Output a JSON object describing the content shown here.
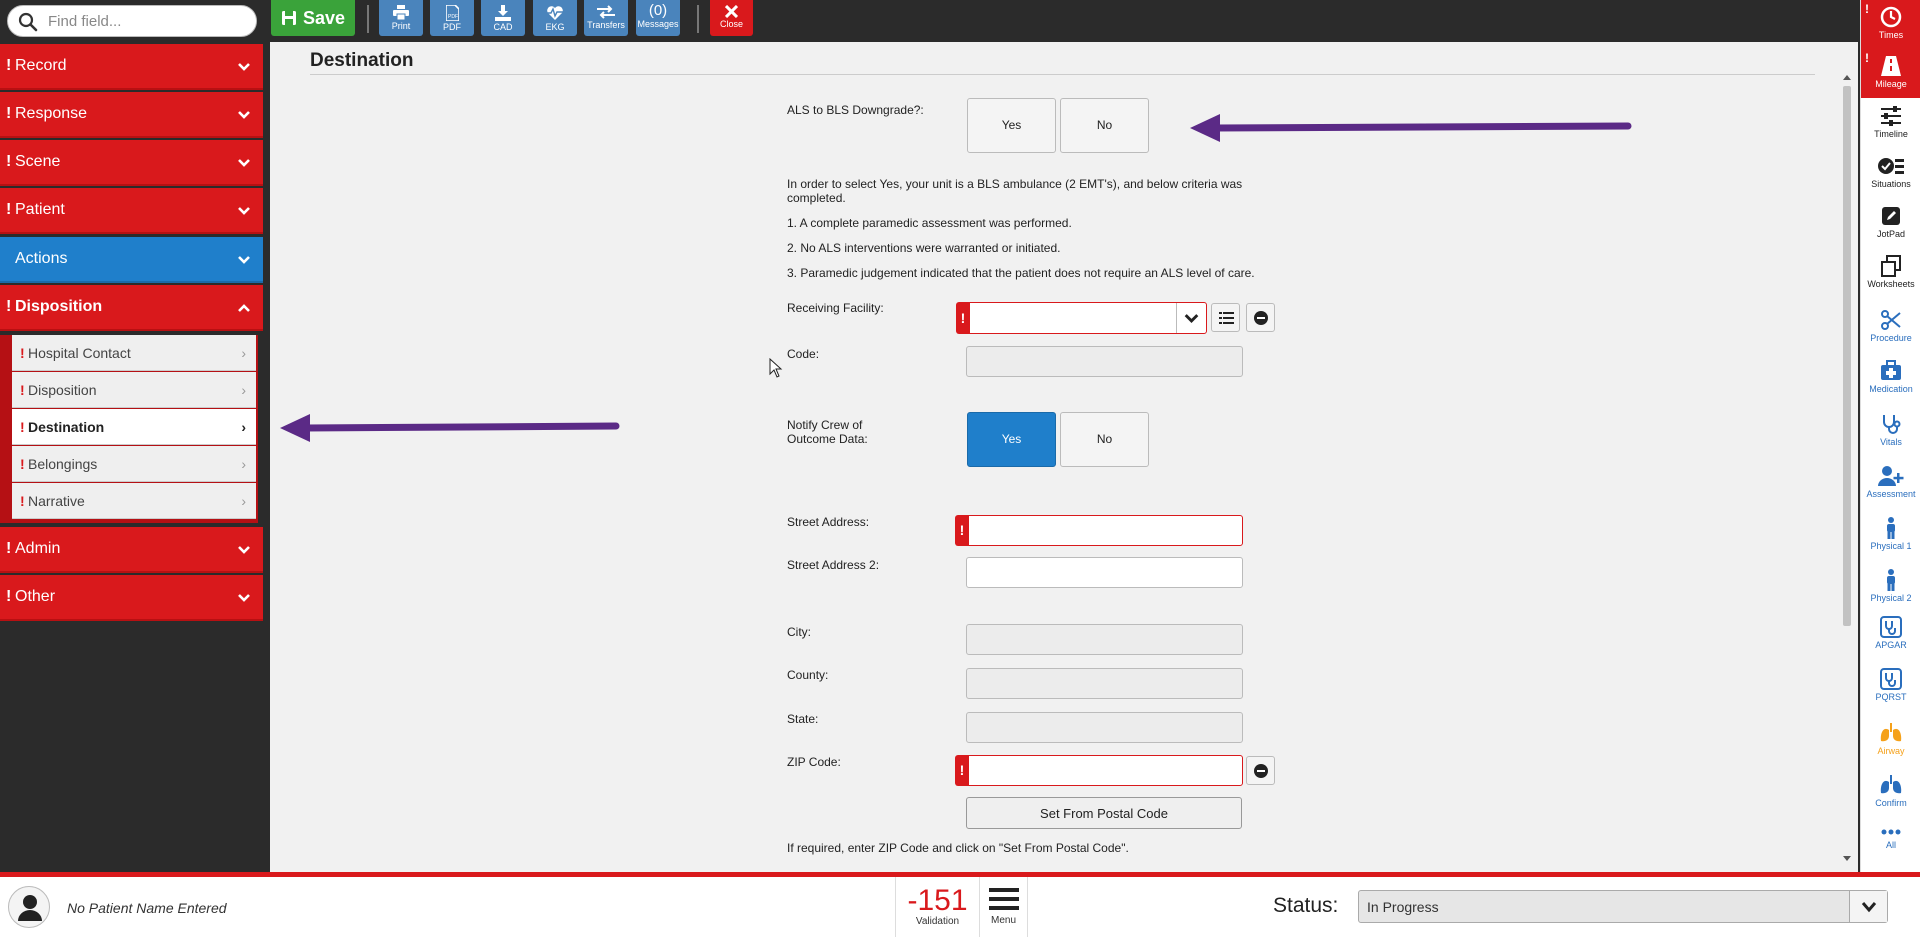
{
  "search": {
    "placeholder": "Find field..."
  },
  "toolbar": {
    "save_label": "Save",
    "print_label": "Print",
    "pdf_label": "PDF",
    "cad_label": "CAD",
    "ekg_label": "EKG",
    "transfers_label": "Transfers",
    "messages_count": "(0)",
    "messages_label": "Messages",
    "close_label": "Close"
  },
  "sidebar": {
    "sections": [
      {
        "label": "Record",
        "required": "!"
      },
      {
        "label": "Response",
        "required": "!"
      },
      {
        "label": "Scene",
        "required": "!"
      },
      {
        "label": "Patient",
        "required": "!"
      },
      {
        "label": "Actions"
      },
      {
        "label": "Disposition",
        "required": "!"
      },
      {
        "label": "Admin",
        "required": "!"
      },
      {
        "label": "Other",
        "required": "!"
      }
    ],
    "subitems": [
      {
        "label": "Hospital Contact",
        "required": "!"
      },
      {
        "label": "Disposition",
        "required": "!"
      },
      {
        "label": "Destination",
        "required": "!"
      },
      {
        "label": "Belongings",
        "required": "!"
      },
      {
        "label": "Narrative",
        "required": "!"
      }
    ]
  },
  "main": {
    "title": "Destination",
    "downgrade": {
      "label": "ALS to BLS Downgrade?:",
      "yes": "Yes",
      "no": "No"
    },
    "criteria": [
      "In order to select Yes, your unit is a BLS ambulance (2 EMT's), and below criteria was completed.",
      "1. A complete paramedic assessment was performed.",
      "2. No ALS interventions were warranted or initiated.",
      "3. Paramedic judgement indicated that the patient does not require an ALS level of care."
    ],
    "receiving_facility_label": "Receiving Facility:",
    "receiving_facility_value": "",
    "code_label": "Code:",
    "notify": {
      "label": "Notify Crew of Outcome Data:",
      "yes": "Yes",
      "no": "No",
      "selected": "Yes"
    },
    "street_label": "Street Address:",
    "street2_label": "Street Address 2:",
    "city_label": "City:",
    "county_label": "County:",
    "state_label": "State:",
    "zip_label": "ZIP Code:",
    "postal_button": "Set From Postal Code",
    "postal_hint": "If required, enter ZIP Code and click on \"Set From Postal Code\"."
  },
  "rightbar": [
    {
      "label": "Times",
      "icon": "clock-icon",
      "style": "red"
    },
    {
      "label": "Mileage",
      "icon": "road-icon",
      "style": "red"
    },
    {
      "label": "Timeline",
      "icon": "sliders-icon",
      "style": "dark"
    },
    {
      "label": "Situations",
      "icon": "checklist-icon",
      "style": "dark"
    },
    {
      "label": "JotPad",
      "icon": "pen-icon",
      "style": "dark"
    },
    {
      "label": "Worksheets",
      "icon": "copy-icon",
      "style": "dark"
    },
    {
      "label": "Procedure",
      "icon": "scissors-icon",
      "style": "blue"
    },
    {
      "label": "Medication",
      "icon": "medkit-icon",
      "style": "blue"
    },
    {
      "label": "Vitals",
      "icon": "stethoscope-icon",
      "style": "blue"
    },
    {
      "label": "Assessment",
      "icon": "user-plus-icon",
      "style": "blue"
    },
    {
      "label": "Physical 1",
      "icon": "person-icon",
      "style": "blue"
    },
    {
      "label": "Physical 2",
      "icon": "person-icon",
      "style": "blue"
    },
    {
      "label": "APGAR",
      "icon": "stethoscope-icon",
      "style": "blue"
    },
    {
      "label": "PQRST",
      "icon": "stethoscope-icon",
      "style": "blue"
    },
    {
      "label": "Airway",
      "icon": "lungs-icon",
      "style": "orange"
    },
    {
      "label": "Confirm",
      "icon": "lungs-icon",
      "style": "blue"
    },
    {
      "label": "All",
      "icon": "more-icon",
      "style": "blue"
    }
  ],
  "bottom": {
    "patient_name": "No Patient Name Entered",
    "validation_count": "-151",
    "validation_label": "Validation",
    "menu_label": "Menu",
    "status_label": "Status:",
    "status_value": "In Progress"
  },
  "colors": {
    "red": "#d9191c",
    "blue": "#1f7fcb",
    "green": "#3aa33a",
    "arrow": "#5b2a86"
  }
}
